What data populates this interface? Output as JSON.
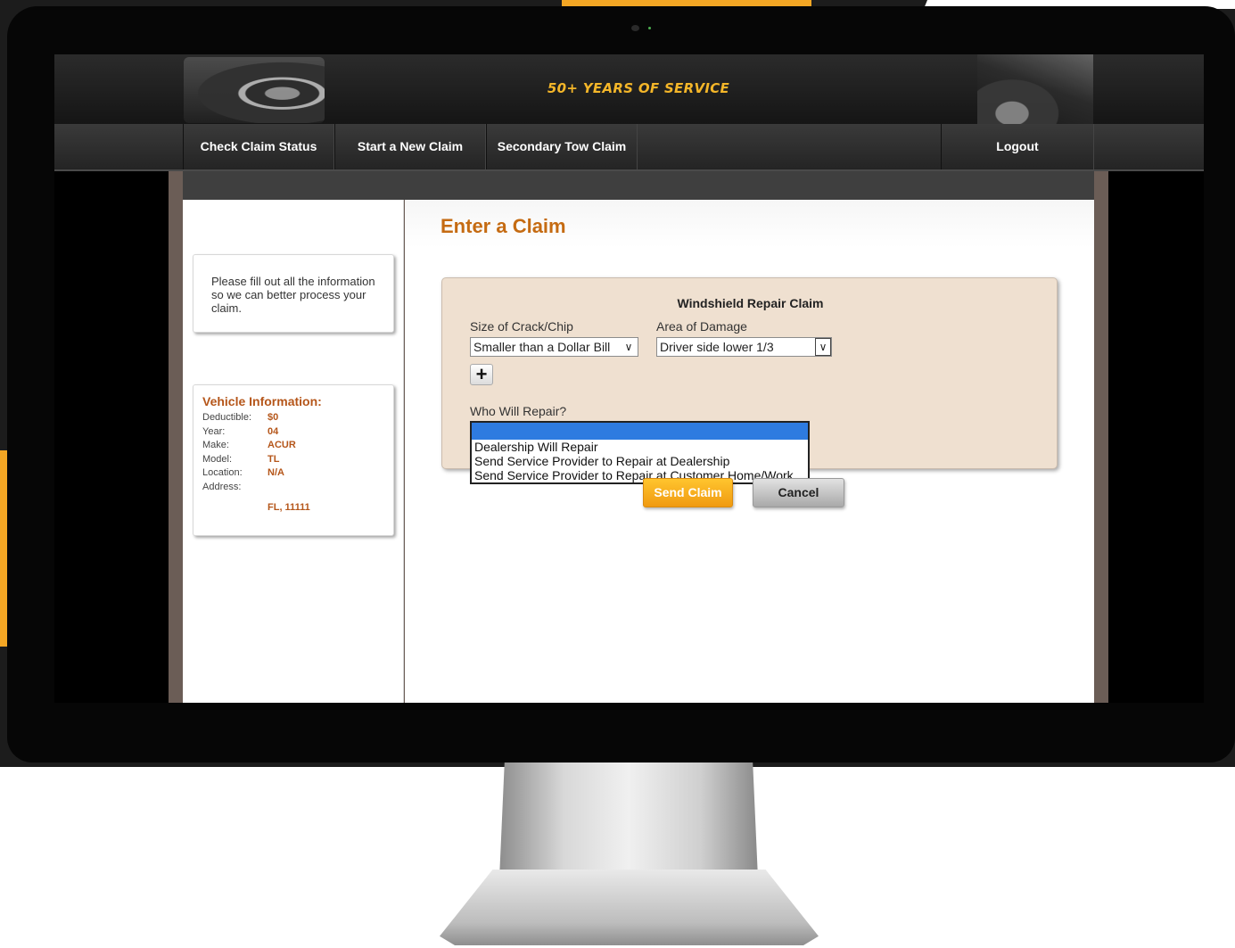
{
  "header": {
    "tagline": "50+ YEARS OF SERVICE"
  },
  "nav": {
    "items": [
      {
        "label": "Check Claim Status"
      },
      {
        "label": "Start a New Claim"
      },
      {
        "label": "Secondary Tow Claim"
      },
      {
        "label": "Logout"
      }
    ]
  },
  "sidebar": {
    "note": "Please fill out all the information so we can better process your claim.",
    "vehicle": {
      "title": "Vehicle Information:",
      "rows": [
        {
          "label": "Deductible:",
          "value": "$0"
        },
        {
          "label": "Year:",
          "value": "04"
        },
        {
          "label": "Make:",
          "value": "ACUR"
        },
        {
          "label": "Model:",
          "value": "TL"
        },
        {
          "label": "Location:",
          "value": "N/A"
        },
        {
          "label": "Address:",
          "value": ""
        },
        {
          "label": "",
          "value": "FL, 11111"
        }
      ]
    }
  },
  "main": {
    "title": "Enter a Claim",
    "form": {
      "title": "Windshield Repair Claim",
      "crack_size": {
        "label": "Size of Crack/Chip",
        "value": "Smaller than a Dollar Bill"
      },
      "damage_area": {
        "label": "Area of Damage",
        "value": "Driver side lower 1/3"
      },
      "who_repair": {
        "label": "Who Will Repair?",
        "options": [
          "Dealership Will Repair",
          "Send Service Provider to Repair at Dealership",
          "Send Service Provider to Repair at Customer Home/Work"
        ]
      },
      "send_label": "Send Claim",
      "cancel_label": "Cancel"
    }
  },
  "icons": {
    "plus": "plus-icon",
    "select_arrow": "chevron-down-icon"
  },
  "colors": {
    "accent_orange": "#c56b12",
    "tagline_gold": "#f4b629",
    "panel_bg": "#efe0d0",
    "selected_blue": "#2e7be0"
  }
}
